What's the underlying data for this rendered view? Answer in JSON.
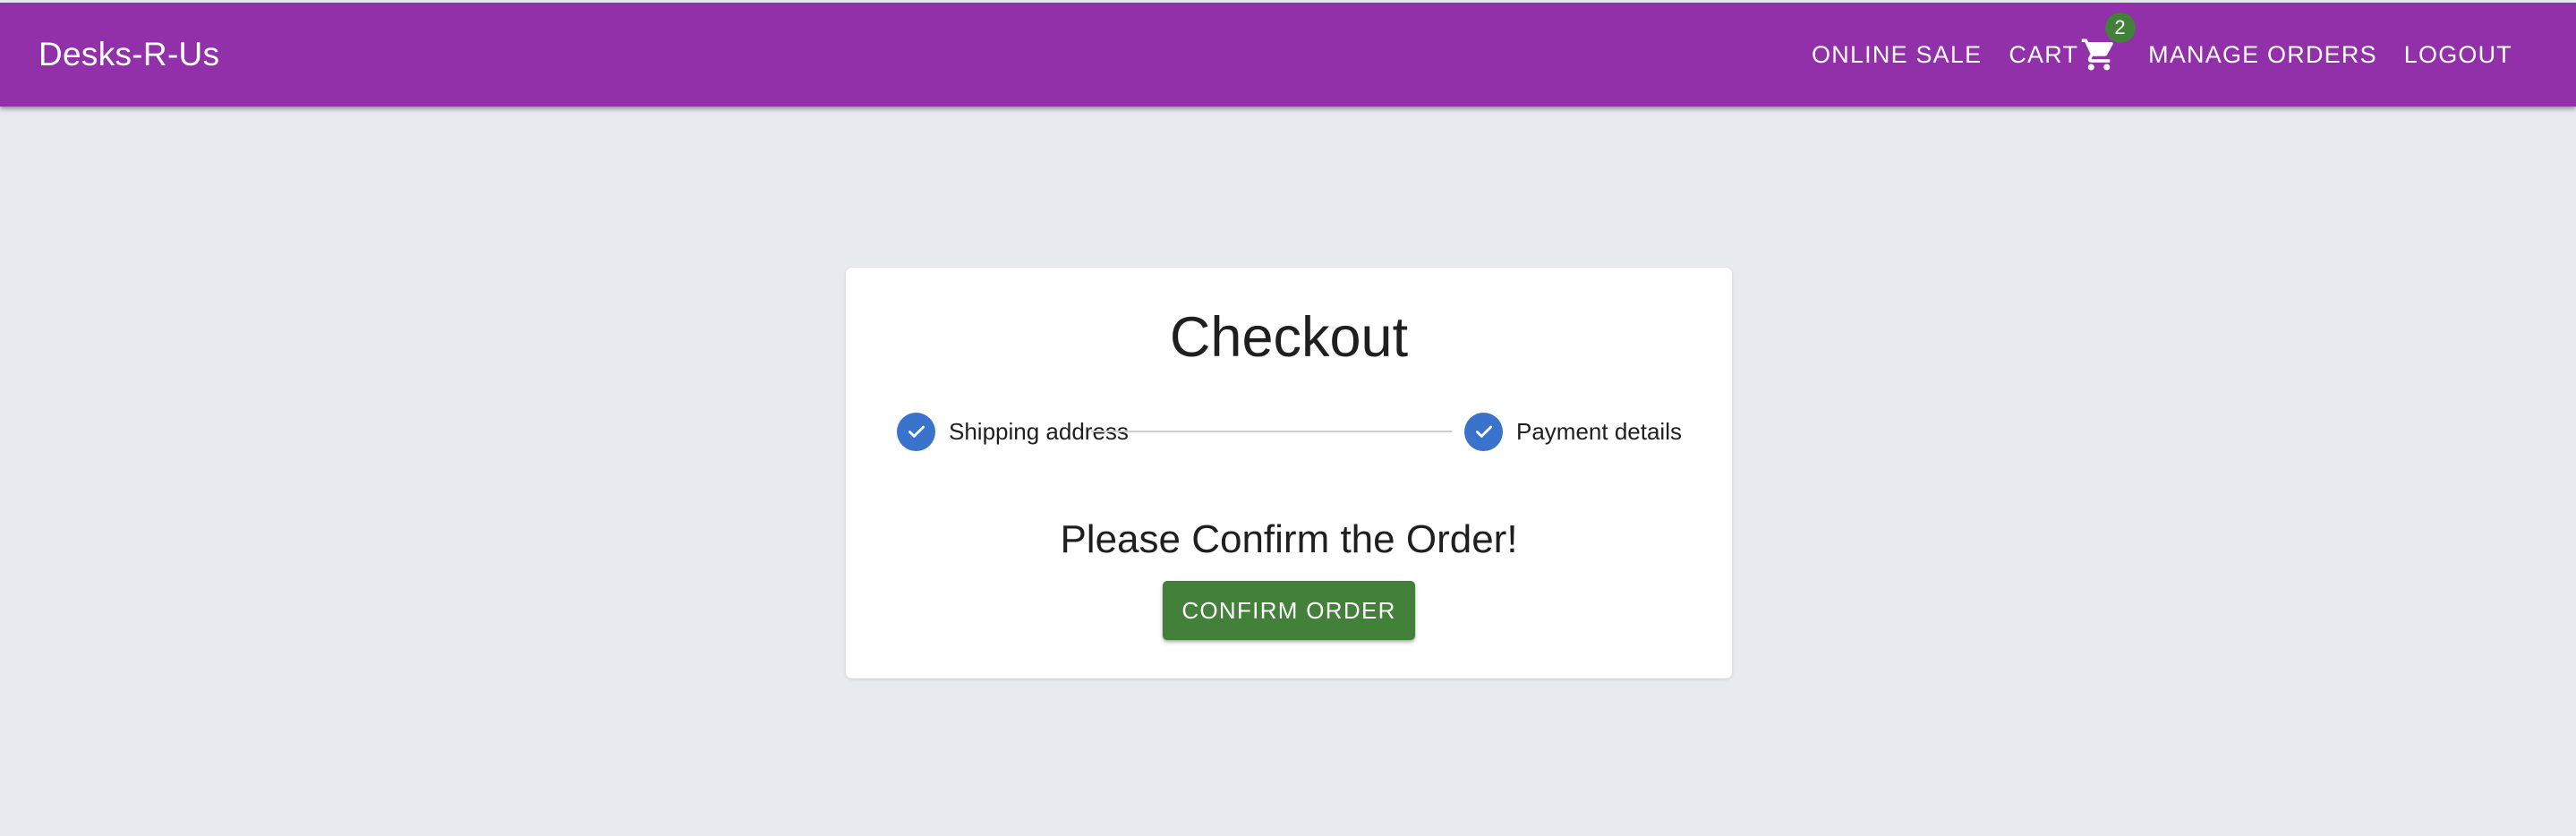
{
  "appbar": {
    "brand": "Desks-R-Us",
    "color": "#9230aa",
    "nav": {
      "online_sale": "ONLINE SALE",
      "cart": "CART",
      "cart_icon": "shopping-cart-icon",
      "cart_count": "2",
      "manage_orders": "MANAGE ORDERS",
      "logout": "LOGOUT"
    }
  },
  "checkout": {
    "title": "Checkout",
    "steps": [
      {
        "label": "Shipping address",
        "status": "completed",
        "icon": "check-icon"
      },
      {
        "label": "Payment details",
        "status": "completed",
        "icon": "check-icon"
      }
    ],
    "confirm_heading": "Please Confirm the Order!",
    "confirm_button": "CONFIRM ORDER"
  },
  "colors": {
    "background": "#e7eaef",
    "accent_green": "#43803a",
    "step_blue": "#3a73cc"
  }
}
